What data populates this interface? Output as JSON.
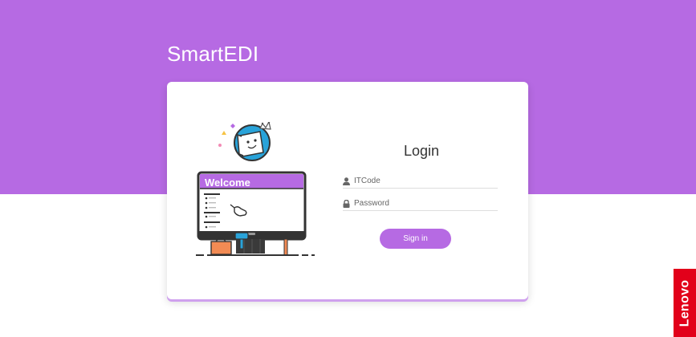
{
  "app": {
    "title": "SmartEDI"
  },
  "illustration": {
    "screen_title": "Welcome",
    "icons": [
      "face-badge-icon",
      "crown-icon",
      "pointer-hand-icon",
      "lamp-icon",
      "package-icon"
    ]
  },
  "login": {
    "heading": "Login",
    "itcode": {
      "placeholder": "ITCode",
      "value": "",
      "icon": "user-icon"
    },
    "password": {
      "placeholder": "Password",
      "value": "",
      "icon": "lock-icon"
    },
    "submit_label": "Sign in"
  },
  "brand": {
    "logo_text": "Lenovo"
  },
  "colors": {
    "accent": "#b66ae3",
    "background": "#ffffff",
    "brand_red": "#e2001a",
    "title_text": "#333333"
  }
}
